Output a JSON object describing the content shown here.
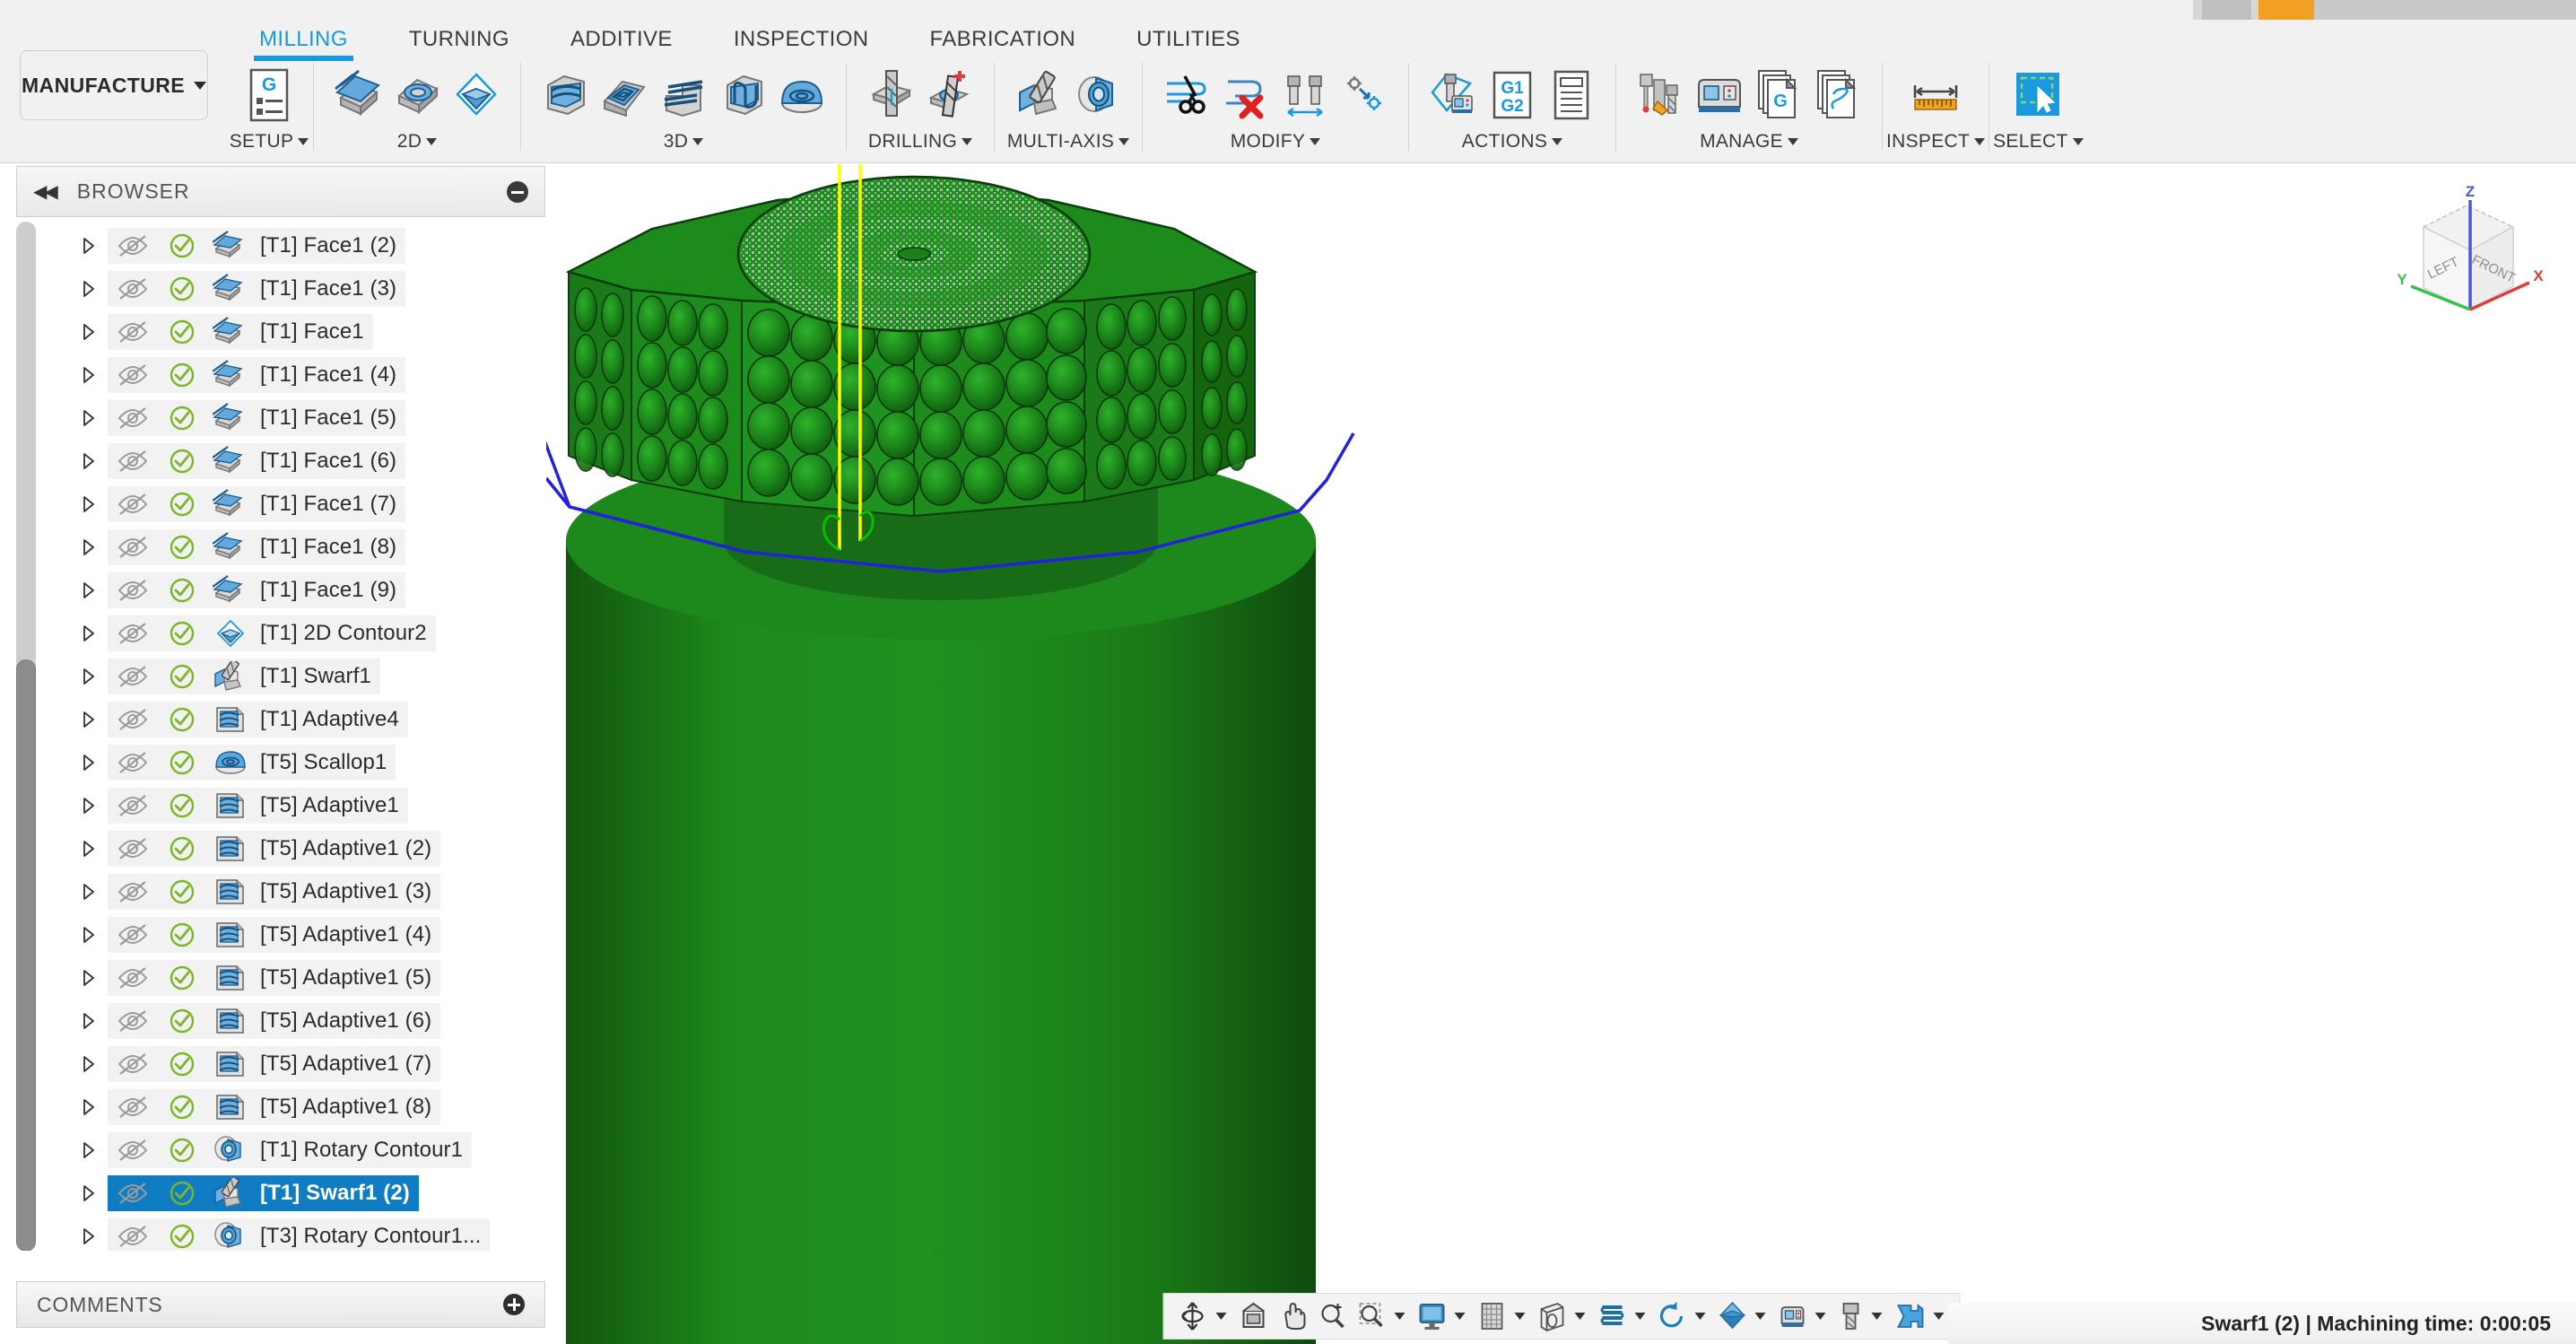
{
  "window": {
    "chrome_accent_color": "#f2a024"
  },
  "app": {
    "workspace_button": "MANUFACTURE",
    "tabs": [
      {
        "label": "MILLING",
        "active": true
      },
      {
        "label": "TURNING",
        "active": false
      },
      {
        "label": "ADDITIVE",
        "active": false
      },
      {
        "label": "INSPECTION",
        "active": false
      },
      {
        "label": "FABRICATION",
        "active": false
      },
      {
        "label": "UTILITIES",
        "active": false
      }
    ],
    "panels": [
      {
        "label": "SETUP",
        "dropdown": true,
        "icons": [
          "setup-g-code-icon"
        ]
      },
      {
        "label": "2D",
        "dropdown": true,
        "icons": [
          "face-icon",
          "pocket-2d-icon",
          "contour-2d-icon"
        ]
      },
      {
        "label": "3D",
        "dropdown": true,
        "icons": [
          "adaptive-clearing-icon",
          "pocket-clearing-icon",
          "horizontal-icon",
          "parallel-icon",
          "scallop-icon"
        ]
      },
      {
        "label": "DRILLING",
        "dropdown": true,
        "icons": [
          "drill-icon",
          "bore-icon"
        ]
      },
      {
        "label": "MULTI-AXIS",
        "dropdown": true,
        "icons": [
          "swarf-icon",
          "rotary-icon"
        ]
      },
      {
        "label": "MODIFY",
        "dropdown": true,
        "icons": [
          "trim-toolpath-icon",
          "delete-toolpath-icon",
          "tool-change-icon",
          "transform-icon"
        ]
      },
      {
        "label": "ACTIONS",
        "dropdown": true,
        "icons": [
          "simulate-icon",
          "g1-g2-machine-icon",
          "setup-sheet-icon"
        ]
      },
      {
        "label": "MANAGE",
        "dropdown": true,
        "icons": [
          "tool-library-icon",
          "machine-library-icon",
          "post-library-icon",
          "template-library-icon"
        ]
      },
      {
        "label": "INSPECT",
        "dropdown": true,
        "icons": [
          "measure-icon"
        ]
      },
      {
        "label": "SELECT",
        "dropdown": true,
        "icons": [
          "select-window-icon"
        ]
      }
    ]
  },
  "browser": {
    "title": "BROWSER",
    "collapse_icon": "collapse-left-icon",
    "minimize_icon": "minimize-icon",
    "items": [
      {
        "label": "[T1] Face1 (2)",
        "icon": "face-operation-icon",
        "selected": false
      },
      {
        "label": "[T1] Face1 (3)",
        "icon": "face-operation-icon",
        "selected": false
      },
      {
        "label": "[T1] Face1",
        "icon": "face-operation-icon",
        "selected": false
      },
      {
        "label": "[T1] Face1 (4)",
        "icon": "face-operation-icon",
        "selected": false
      },
      {
        "label": "[T1] Face1 (5)",
        "icon": "face-operation-icon",
        "selected": false
      },
      {
        "label": "[T1] Face1 (6)",
        "icon": "face-operation-icon",
        "selected": false
      },
      {
        "label": "[T1] Face1 (7)",
        "icon": "face-operation-icon",
        "selected": false
      },
      {
        "label": "[T1] Face1 (8)",
        "icon": "face-operation-icon",
        "selected": false
      },
      {
        "label": "[T1] Face1 (9)",
        "icon": "face-operation-icon",
        "selected": false
      },
      {
        "label": "[T1] 2D Contour2",
        "icon": "contour-operation-icon",
        "selected": false
      },
      {
        "label": "[T1] Swarf1",
        "icon": "swarf-operation-icon",
        "selected": false
      },
      {
        "label": "[T1] Adaptive4",
        "icon": "adaptive-operation-icon",
        "selected": false
      },
      {
        "label": "[T5] Scallop1",
        "icon": "scallop-operation-icon",
        "selected": false
      },
      {
        "label": "[T5] Adaptive1",
        "icon": "adaptive-operation-icon",
        "selected": false
      },
      {
        "label": "[T5] Adaptive1 (2)",
        "icon": "adaptive-operation-icon",
        "selected": false
      },
      {
        "label": "[T5] Adaptive1 (3)",
        "icon": "adaptive-operation-icon",
        "selected": false
      },
      {
        "label": "[T5] Adaptive1 (4)",
        "icon": "adaptive-operation-icon",
        "selected": false
      },
      {
        "label": "[T5] Adaptive1 (5)",
        "icon": "adaptive-operation-icon",
        "selected": false
      },
      {
        "label": "[T5] Adaptive1 (6)",
        "icon": "adaptive-operation-icon",
        "selected": false
      },
      {
        "label": "[T5] Adaptive1 (7)",
        "icon": "adaptive-operation-icon",
        "selected": false
      },
      {
        "label": "[T5] Adaptive1 (8)",
        "icon": "adaptive-operation-icon",
        "selected": false
      },
      {
        "label": "[T1] Rotary Contour1",
        "icon": "rotary-operation-icon",
        "selected": false
      },
      {
        "label": "[T1] Swarf1 (2)",
        "icon": "swarf-operation-icon",
        "selected": true
      },
      {
        "label": "[T3] Rotary Contour1...",
        "icon": "rotary-operation-icon",
        "selected": false
      }
    ]
  },
  "comments": {
    "title": "COMMENTS",
    "add_icon": "add-comment-icon"
  },
  "viewcube": {
    "face_left": "LEFT",
    "face_front": "FRONT",
    "axis_x": "X",
    "axis_y": "Y",
    "axis_z": "Z",
    "color_x": "#e23b3b",
    "color_y": "#38c24a",
    "color_z": "#4b57d6"
  },
  "navbar": {
    "buttons": [
      {
        "name": "orbit-icon",
        "dropdown": true
      },
      {
        "name": "look-at-icon",
        "dropdown": false
      },
      {
        "name": "pan-icon",
        "dropdown": false
      },
      {
        "name": "zoom-icon",
        "dropdown": false
      },
      {
        "name": "zoom-window-icon",
        "dropdown": true
      },
      {
        "name": "display-settings-icon",
        "dropdown": true
      },
      {
        "name": "grid-snaps-icon",
        "dropdown": true
      },
      {
        "name": "viewports-icon",
        "dropdown": true
      },
      {
        "name": "stock-visibility-icon",
        "dropdown": true
      },
      {
        "name": "refresh-icon",
        "dropdown": true
      },
      {
        "name": "object-visibility-icon",
        "dropdown": true
      },
      {
        "name": "machine-visibility-icon",
        "dropdown": true
      },
      {
        "name": "tool-visibility-icon",
        "dropdown": true
      },
      {
        "name": "toolpath-visibility-icon",
        "dropdown": true
      }
    ]
  },
  "status": {
    "text": "Swarf1 (2) | Machining time: 0:00:05"
  },
  "model": {
    "body_color": "#1b7a1e",
    "body_color_dark": "#176a19",
    "toolpath_rapid_color": "#2222dd",
    "toolpath_cut_color": "#00c000",
    "tool_axis_color": "#ffff00"
  }
}
